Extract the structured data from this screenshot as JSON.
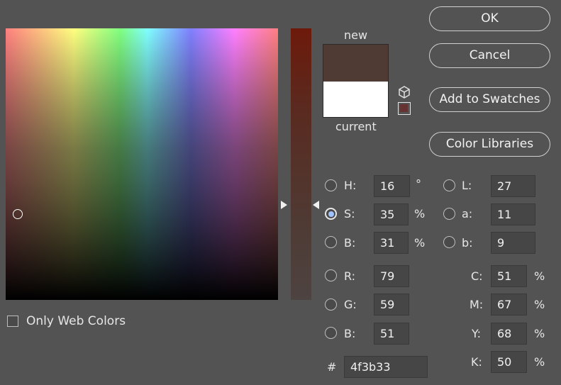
{
  "preview": {
    "new_label": "new",
    "current_label": "current",
    "new_color": "#4f3b33",
    "current_color": "#ffffff",
    "websafe_color": "#663333"
  },
  "buttons": {
    "ok": "OK",
    "cancel": "Cancel",
    "add_to_swatches": "Add to Swatches",
    "color_libraries": "Color Libraries"
  },
  "hsb": {
    "h_label": "H:",
    "h_value": "16",
    "h_unit": "°",
    "s_label": "S:",
    "s_value": "35",
    "s_unit": "%",
    "b_label": "B:",
    "b_value": "31",
    "b_unit": "%"
  },
  "rgb": {
    "r_label": "R:",
    "r_value": "79",
    "g_label": "G:",
    "g_value": "59",
    "b_label": "B:",
    "b_value": "51"
  },
  "lab": {
    "l_label": "L:",
    "l_value": "27",
    "a_label": "a:",
    "a_value": "11",
    "b_label": "b:",
    "b_value": "9"
  },
  "cmyk": {
    "c_label": "C:",
    "c_value": "51",
    "m_label": "M:",
    "m_value": "67",
    "y_label": "Y:",
    "y_value": "68",
    "k_label": "K:",
    "k_value": "50",
    "unit": "%"
  },
  "hex": {
    "label": "#",
    "value": "4f3b33"
  },
  "only_web_colors": {
    "label": "Only Web Colors",
    "checked": false
  },
  "selected_mode": "S",
  "icons": {
    "gamut": "cube-icon",
    "slider_arrow": "triangle-icon"
  }
}
